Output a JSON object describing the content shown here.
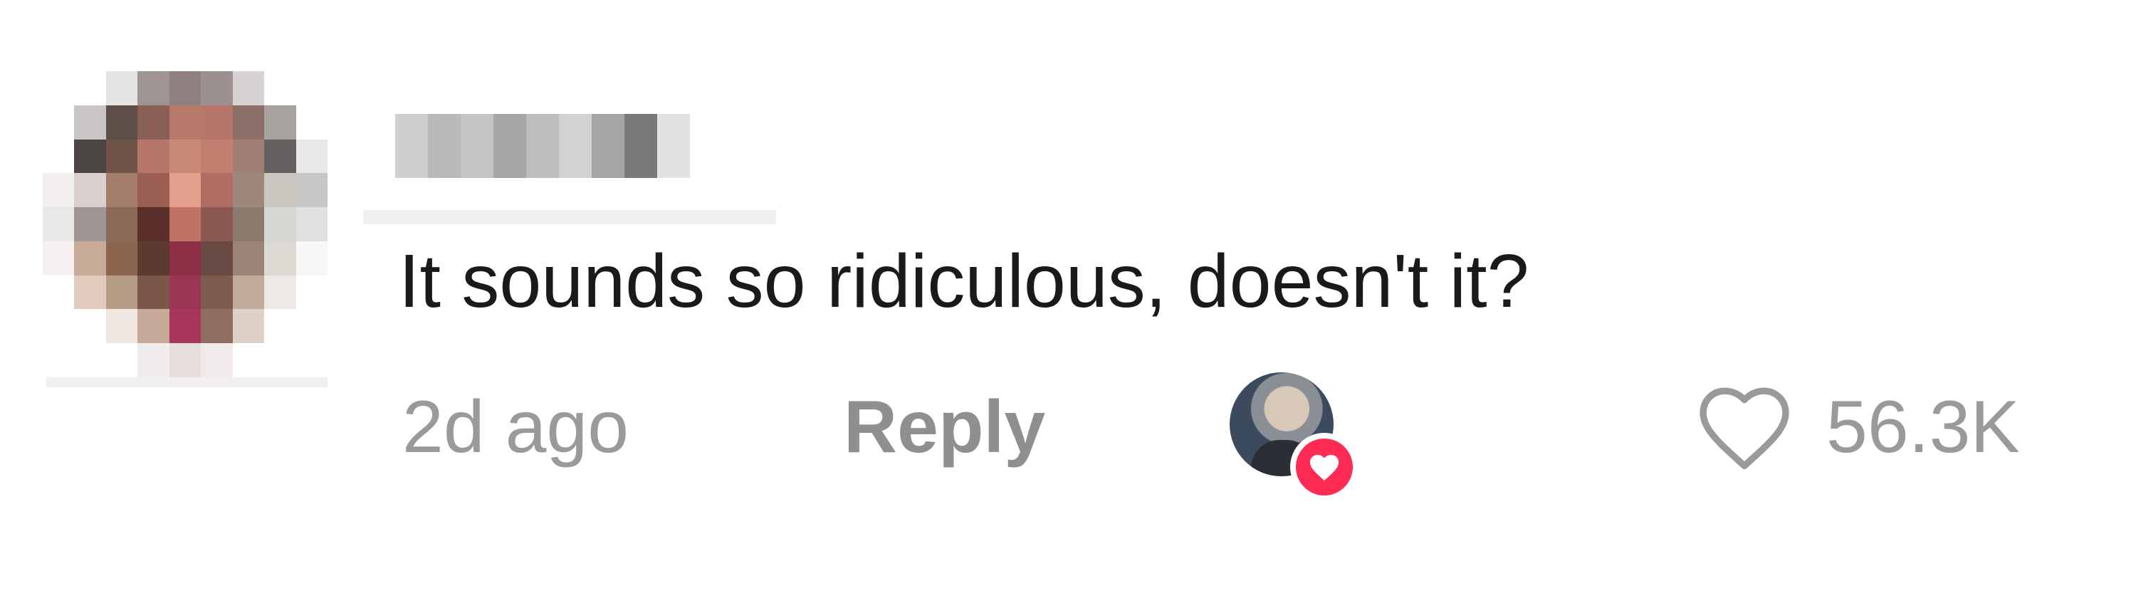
{
  "comment": {
    "text": "It sounds so ridiculous, doesn't it?",
    "time_ago": "2d ago",
    "reply_label": "Reply",
    "like_count": "56.3K",
    "liked_by_creator": true
  },
  "colors": {
    "text_primary": "#1a1a1a",
    "text_secondary": "#9a9a9a",
    "heart_badge": "#fe2c55"
  },
  "icons": {
    "like": "heart-outline-icon",
    "creator_like": "heart-filled-icon"
  }
}
